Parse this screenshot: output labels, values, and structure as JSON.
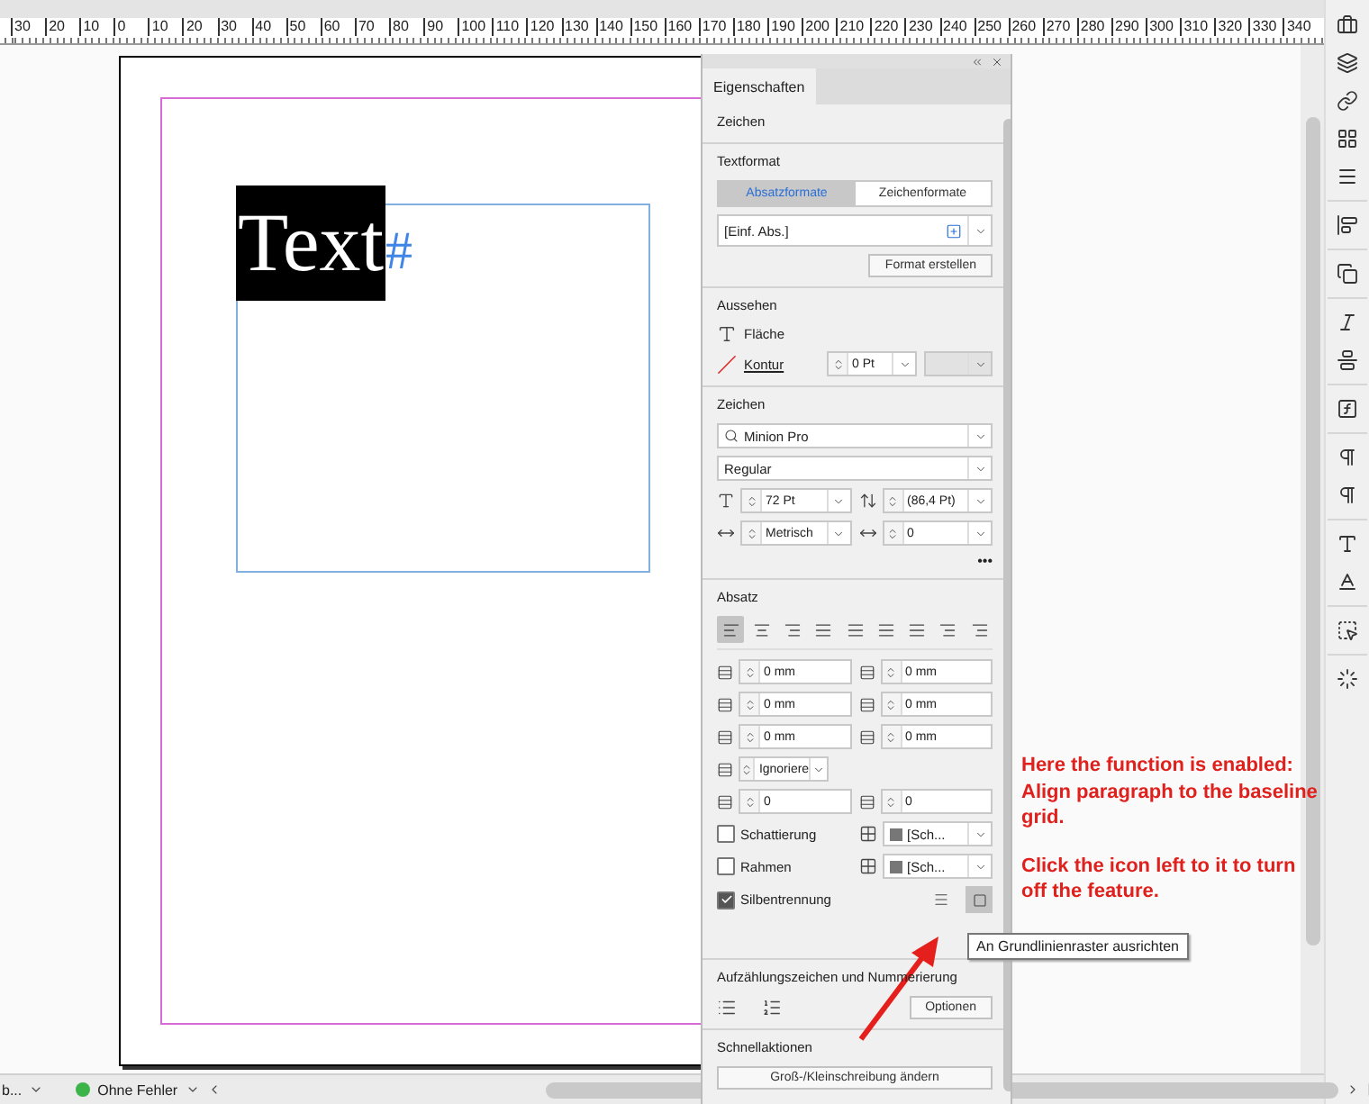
{
  "ruler": {
    "labels": [
      "30",
      "20",
      "10",
      "0",
      "10",
      "20",
      "30",
      "40",
      "50",
      "60",
      "70",
      "80",
      "90",
      "100",
      "110",
      "120",
      "130",
      "140",
      "150",
      "160",
      "170",
      "180",
      "190",
      "200",
      "210",
      "220",
      "230",
      "240",
      "250",
      "260",
      "270",
      "280",
      "290",
      "300",
      "310",
      "320",
      "330",
      "340"
    ]
  },
  "document": {
    "frame_text": "Text",
    "end_marker": "#"
  },
  "panel": {
    "tab": "Eigenschaften",
    "context": "Zeichen",
    "textformat": {
      "title": "Textformat",
      "tabs": [
        {
          "label": "Absatzformate",
          "selected": true
        },
        {
          "label": "Zeichenformate",
          "selected": false
        }
      ],
      "style": "[Einf. Abs.]",
      "create_button": "Format erstellen"
    },
    "appearance": {
      "title": "Aussehen",
      "fill_label": "Fläche",
      "stroke_label": "Kontur",
      "stroke_weight": "0 Pt"
    },
    "character": {
      "title": "Zeichen",
      "font": "Minion Pro",
      "style": "Regular",
      "size": "72 Pt",
      "leading": "(86,4 Pt)",
      "kerning": "Metrisch",
      "tracking": "0",
      "more": "•••"
    },
    "paragraph": {
      "title": "Absatz",
      "alignments": [
        {
          "selected": true
        },
        {
          "selected": false
        },
        {
          "selected": false
        },
        {
          "selected": false
        },
        {
          "selected": false
        },
        {
          "selected": false
        },
        {
          "selected": false
        },
        {
          "selected": false
        },
        {
          "selected": false
        }
      ],
      "indents": [
        "0 mm",
        "0 mm",
        "0 mm",
        "0 mm",
        "0 mm",
        "0 mm"
      ],
      "grid_option": "Ignoriere",
      "drop_cap": [
        "0",
        "0"
      ],
      "options": [
        {
          "label": "Schattierung",
          "checked": false,
          "swatch": "[Sch..."
        },
        {
          "label": "Rahmen",
          "checked": false,
          "swatch": "[Sch..."
        },
        {
          "label": "Silbentrennung",
          "checked": true
        }
      ],
      "grid_buttons": [
        {
          "selected": false
        },
        {
          "selected": true
        }
      ]
    },
    "lists": {
      "title": "Aufzählungszeichen und Nummerierung",
      "options_button": "Optionen"
    },
    "quick_actions": {
      "title": "Schnellaktionen",
      "button": "Groß-/Kleinschreibung ändern"
    }
  },
  "annotation": [
    "Here the function is enabled: Align paragraph to the baseline grid.",
    "Click the icon left to it to turn off the feature."
  ],
  "tooltip": "An Grundlinienraster ausrichten",
  "status_bar": {
    "page": "b...",
    "preflight": {
      "label": "Ohne Fehler",
      "color": "#3cb44a"
    }
  }
}
